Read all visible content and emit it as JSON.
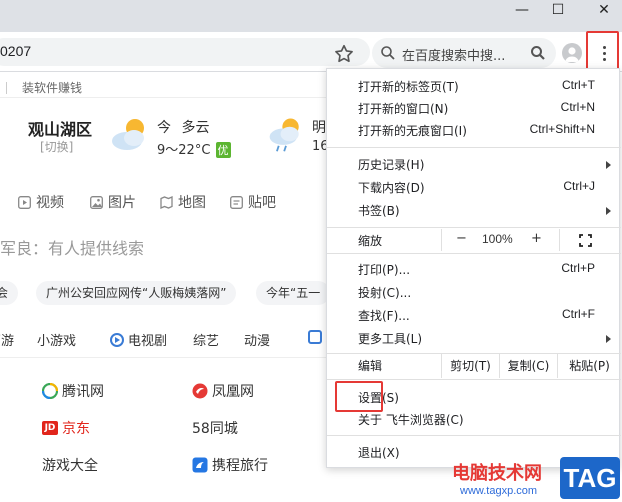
{
  "window": {
    "minimize_glyph": "—",
    "maximize_glyph": "☐",
    "close_glyph": "✕"
  },
  "toolbar": {
    "address_text": "0207",
    "search_placeholder": "在百度搜索中搜..."
  },
  "page": {
    "promo_text": "装软件赚钱",
    "weather": {
      "city": "观山湖区",
      "switch_label": "[切换]",
      "today_label": "今",
      "today_condition": "多云",
      "today_temp": "9～22°C",
      "air_quality": "优",
      "tomorrow_label": "明",
      "tomorrow_temp": "16"
    },
    "search_tabs": [
      "视频",
      "图片",
      "地图",
      "贴吧"
    ],
    "query_text": "军良：有人提供线索",
    "hot_chips": [
      "会",
      "广州公安回应网传“人贩梅姨落网”",
      "今年“五一"
    ],
    "categories": [
      "页游",
      "小游戏",
      "电视剧",
      "综艺",
      "动漫"
    ],
    "links": [
      {
        "label": "腾讯网"
      },
      {
        "label": "凤凰网"
      },
      {
        "label": "京东",
        "icon_text": "JD"
      },
      {
        "label": "58同城"
      },
      {
        "label": "游戏大全"
      },
      {
        "label": "携程旅行"
      }
    ]
  },
  "menu": {
    "items": [
      {
        "label": "打开新的标签页(T)",
        "shortcut": "Ctrl+T"
      },
      {
        "label": "打开新的窗口(N)",
        "shortcut": "Ctrl+N"
      },
      {
        "label": "打开新的无痕窗口(I)",
        "shortcut": "Ctrl+Shift+N"
      },
      {
        "label": "历史记录(H)",
        "shortcut": ""
      },
      {
        "label": "下载内容(D)",
        "shortcut": "Ctrl+J"
      },
      {
        "label": "书签(B)",
        "shortcut": ""
      }
    ],
    "zoom": {
      "label": "缩放",
      "minus": "−",
      "value": "100%",
      "plus": "+"
    },
    "items2": [
      {
        "label": "打印(P)...",
        "shortcut": "Ctrl+P"
      },
      {
        "label": "投射(C)...",
        "shortcut": ""
      },
      {
        "label": "查找(F)...",
        "shortcut": "Ctrl+F"
      },
      {
        "label": "更多工具(L)",
        "shortcut": ""
      }
    ],
    "edit": {
      "label": "编辑",
      "cut": "剪切(T)",
      "copy": "复制(C)",
      "paste": "粘贴(P)"
    },
    "settings": "设置(S)",
    "about": "关于 飞牛浏览器(C)",
    "exit": "退出(X)"
  },
  "watermark": {
    "site_name": "电脑技术网",
    "url": "www.tagxp.com",
    "tag": "TAG"
  },
  "colors": {
    "highlight_red": "#e53935",
    "air_quality_green": "#5cb531",
    "link_blue": "#2e6bd9"
  }
}
